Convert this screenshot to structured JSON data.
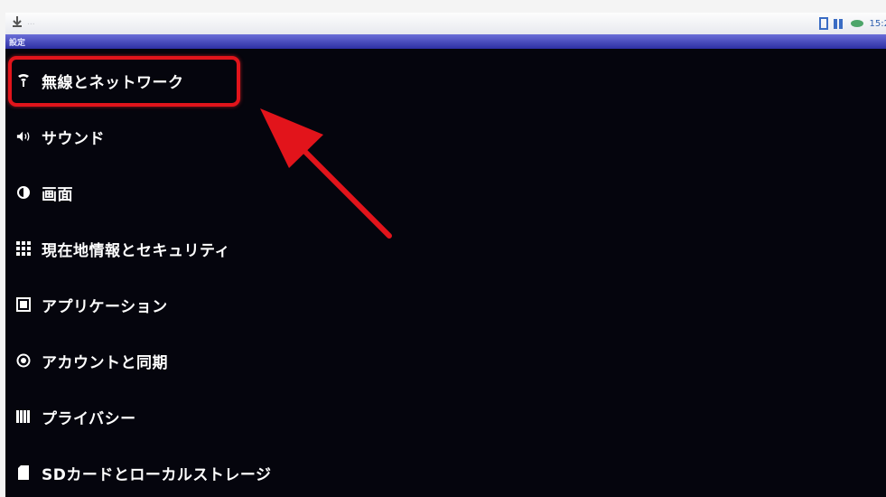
{
  "status_bar": {
    "notification_text": "...",
    "time": "15:2",
    "icons": [
      "download-icon",
      "sync-icon",
      "signal-icon",
      "battery-icon"
    ]
  },
  "title_bar": {
    "title": "設定"
  },
  "menu": {
    "items": [
      {
        "icon": "wifi-icon",
        "label": "無線とネットワーク"
      },
      {
        "icon": "sound-icon",
        "label": "サウンド"
      },
      {
        "icon": "brightness-icon",
        "label": "画面"
      },
      {
        "icon": "location-grid-icon",
        "label": "現在地情報とセキュリティ"
      },
      {
        "icon": "apps-icon",
        "label": "アプリケーション"
      },
      {
        "icon": "sync-account-icon",
        "label": "アカウントと同期"
      },
      {
        "icon": "privacy-icon",
        "label": "プライバシー"
      },
      {
        "icon": "sd-card-icon",
        "label": "SDカードとローカルストレージ"
      }
    ]
  },
  "annotation": {
    "highlight_color": "#e2141b",
    "arrow_color": "#e2141b"
  }
}
